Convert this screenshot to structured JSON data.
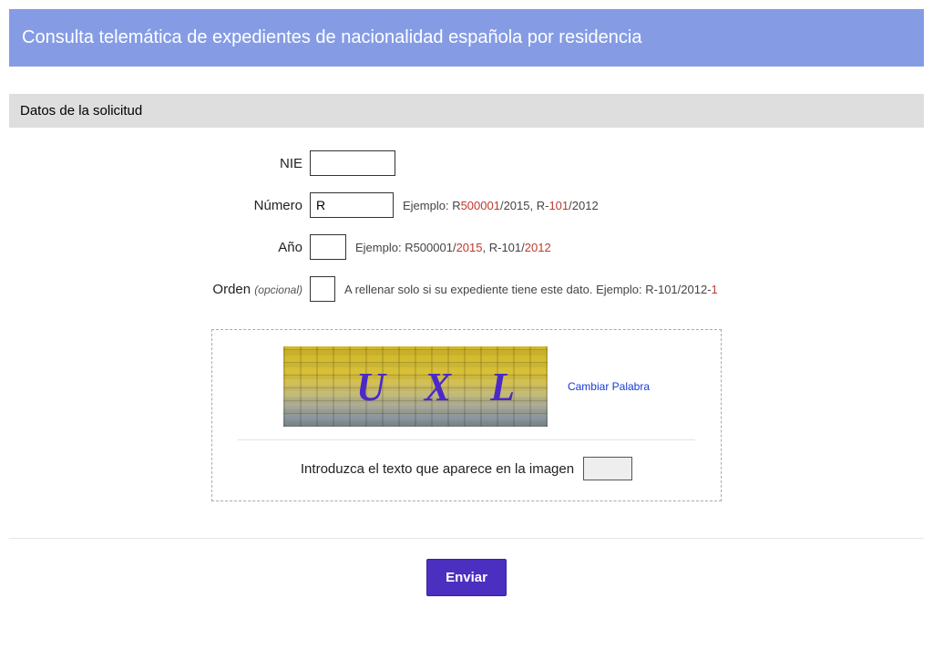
{
  "header": {
    "title": "Consulta telemática de expedientes de nacionalidad española por residencia"
  },
  "section": {
    "title": "Datos de la solicitud"
  },
  "form": {
    "nie": {
      "label": "NIE",
      "value": ""
    },
    "numero": {
      "label": "Número",
      "value": "R",
      "hint_prefix": "Ejemplo: R",
      "hint_red1": "500001",
      "hint_mid": "/2015, R-",
      "hint_red2": "101",
      "hint_suffix": "/2012"
    },
    "ano": {
      "label": "Año",
      "value": "",
      "hint_prefix": "Ejemplo: R500001/",
      "hint_red1": "2015",
      "hint_mid": ", R-101/",
      "hint_red2": "2012",
      "hint_suffix": ""
    },
    "orden": {
      "label": "Orden",
      "optional": "(opcional)",
      "value": "",
      "hint_prefix": "A rellenar solo si su expediente tiene este dato. Ejemplo: R-101/2012-",
      "hint_red1": "1",
      "hint_mid": "",
      "hint_red2": "",
      "hint_suffix": ""
    }
  },
  "captcha": {
    "text": "U X L",
    "change_label": "Cambiar Palabra",
    "input_label": "Introduzca el texto que aparece en la imagen",
    "value": ""
  },
  "submit": {
    "label": "Enviar"
  }
}
